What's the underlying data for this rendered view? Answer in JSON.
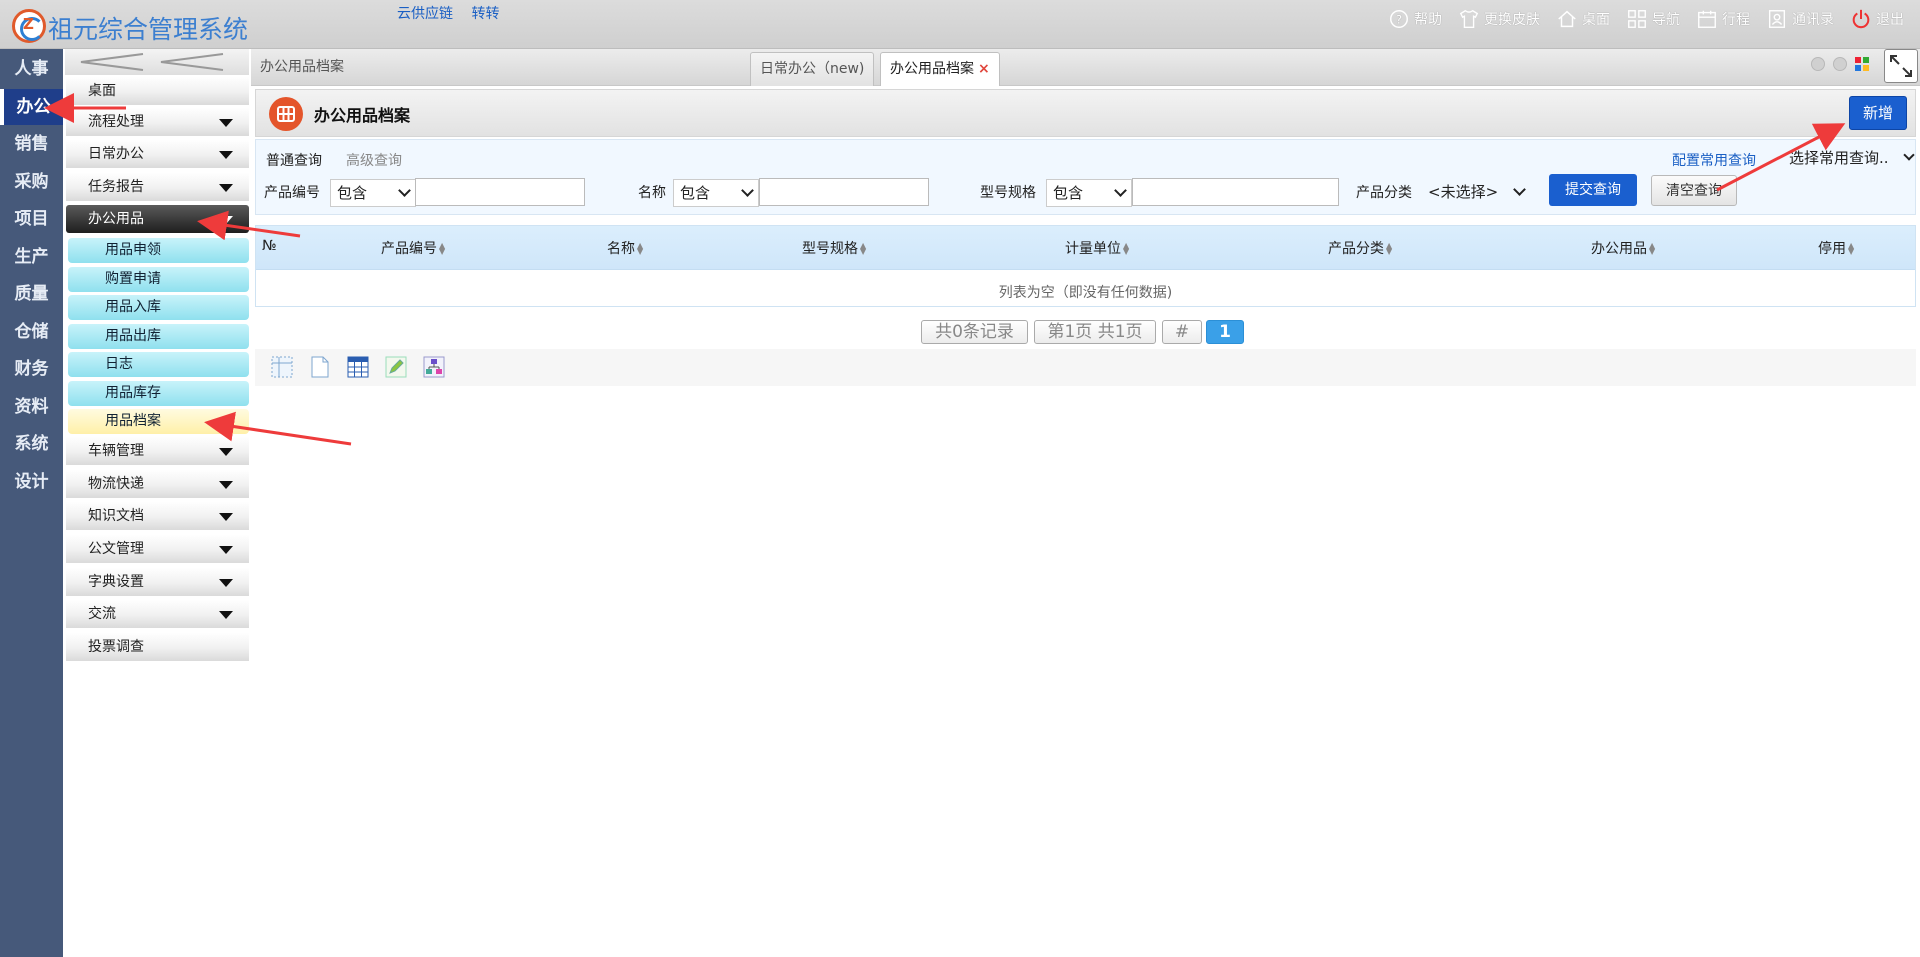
{
  "app": {
    "title": "祖元综合管理系统"
  },
  "top_links": [
    "云供应链",
    "转转"
  ],
  "top_right": [
    {
      "label": "帮助",
      "icon": "help-icon"
    },
    {
      "label": "更换皮肤",
      "icon": "shirt-icon"
    },
    {
      "label": "桌面",
      "icon": "home-icon"
    },
    {
      "label": "导航",
      "icon": "grid-icon"
    },
    {
      "label": "行程",
      "icon": "calendar-icon"
    },
    {
      "label": "通讯录",
      "icon": "contacts-icon"
    },
    {
      "label": "退出",
      "icon": "power-icon"
    }
  ],
  "modules": [
    "人事",
    "办公",
    "销售",
    "采购",
    "项目",
    "生产",
    "质量",
    "仓储",
    "财务",
    "资料",
    "系统",
    "设计"
  ],
  "active_module": "办公",
  "menu": {
    "desktop": "桌面",
    "groups": [
      "流程处理",
      "日常办公",
      "任务报告"
    ],
    "active_group": "办公用品",
    "sub_items": [
      "用品申领",
      "购置申请",
      "用品入库",
      "用品出库",
      "日志",
      "用品库存",
      "用品档案"
    ],
    "selected_sub": "用品档案",
    "lower_groups": [
      "车辆管理",
      "物流快递",
      "知识文档",
      "公文管理",
      "字典设置",
      "交流"
    ],
    "last_item": "投票调查"
  },
  "breadcrumb": "办公用品档案",
  "tabs": [
    {
      "label": "日常办公（new)"
    },
    {
      "label": "办公用品档案",
      "close": "×"
    }
  ],
  "page": {
    "title": "办公用品档案",
    "new_button": "新增"
  },
  "query": {
    "tab_normal": "普通查询",
    "tab_advanced": "高级查询",
    "config_link": "配置常用查询",
    "common_select": "选择常用查询..",
    "fields": [
      {
        "label": "产品编号",
        "op": "包含",
        "value": ""
      },
      {
        "label": "名称",
        "op": "包含",
        "value": ""
      },
      {
        "label": "型号规格",
        "op": "包含",
        "value": ""
      }
    ],
    "category_label": "产品分类",
    "category_value": "<未选择>",
    "submit": "提交查询",
    "clear": "清空查询"
  },
  "grid": {
    "columns": [
      "№",
      "产品编号",
      "名称",
      "型号规格",
      "计量单位",
      "产品分类",
      "办公用品",
      "停用"
    ],
    "empty_text": "列表为空（即没有任何数据)"
  },
  "pager": {
    "total": "共0条记录",
    "page_info": "第1页 共1页",
    "hash": "#",
    "current": "1"
  },
  "colors": {
    "accent": "#1a5fcf",
    "sidebar": "#46597a",
    "annotation_arrow": "#ee3b3b",
    "page_icon": "#e4552b"
  }
}
